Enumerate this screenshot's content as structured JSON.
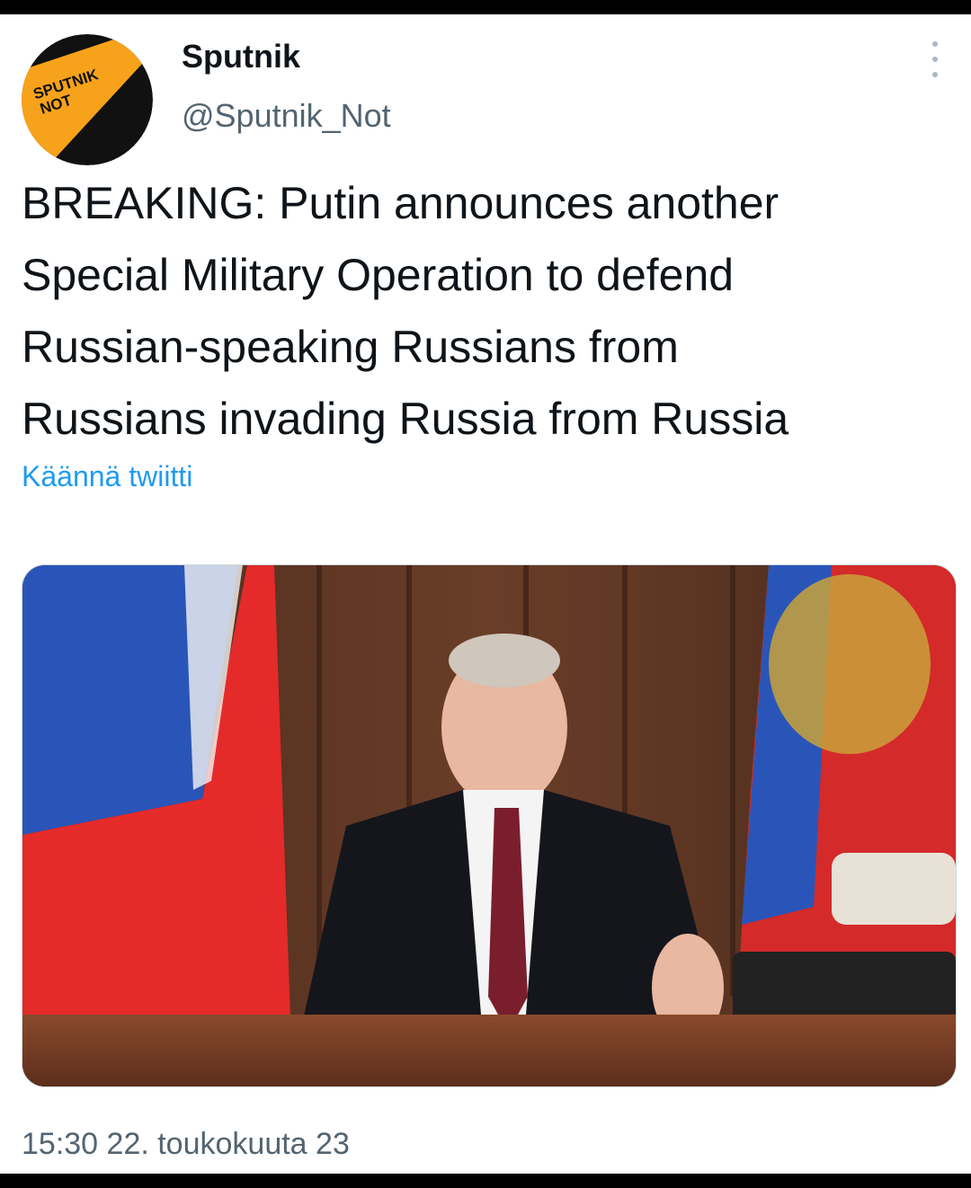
{
  "tweet": {
    "author": {
      "display_name": "Sputnik",
      "handle": "@Sputnik_Not",
      "avatar_text": [
        "SPUTNIK",
        "NOT"
      ],
      "avatar_colors": {
        "dark": "#111111",
        "accent": "#f7a21b"
      }
    },
    "more_icon": "more-vertical-icon",
    "text_lines": [
      "BREAKING: Putin announces another",
      "Special Military Operation to defend",
      "Russian-speaking Russians from",
      "Russians invading Russia from Russia"
    ],
    "translate_label": "Käännä twiitti",
    "timestamp": "15:30 22. toukokuuta 23"
  },
  "colors": {
    "text": "#0f1419",
    "secondary": "#536471",
    "link": "#1d9bf0"
  }
}
